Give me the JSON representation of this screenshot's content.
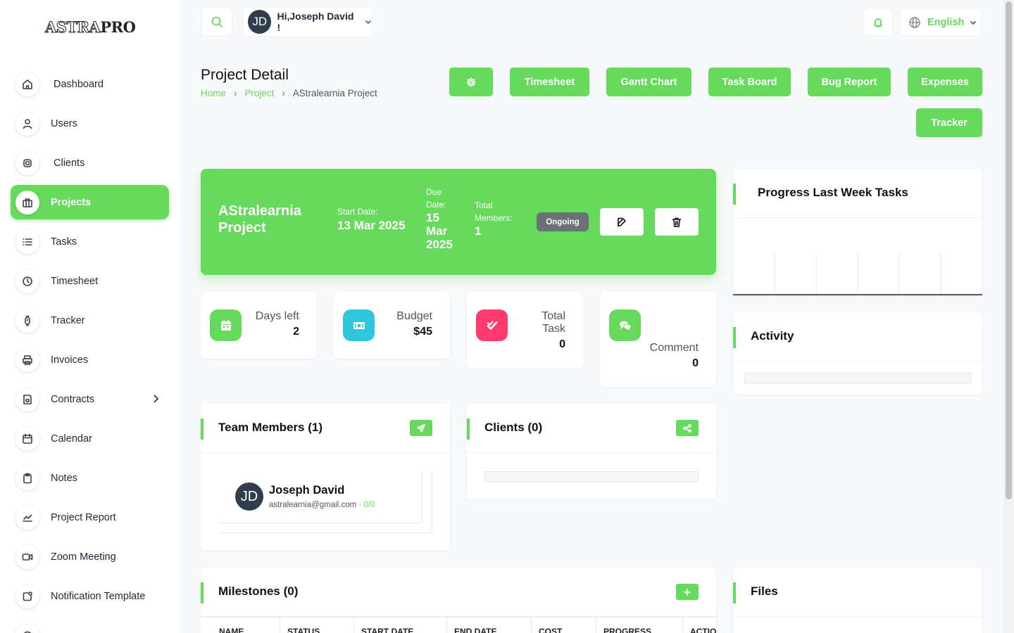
{
  "brand": {
    "logo_outline": "ASTRA",
    "logo_solid": "PRO"
  },
  "sidebar": {
    "items": [
      {
        "label": "Dashboard",
        "icon": "home-icon"
      },
      {
        "label": "Users",
        "icon": "user-icon"
      },
      {
        "label": "Clients",
        "icon": "clients-icon"
      },
      {
        "label": "Projects",
        "icon": "projects-icon",
        "active": true
      },
      {
        "label": "Tasks",
        "icon": "list-icon"
      },
      {
        "label": "Timesheet",
        "icon": "clock-icon"
      },
      {
        "label": "Tracker",
        "icon": "tracker-icon"
      },
      {
        "label": "Invoices",
        "icon": "printer-icon"
      },
      {
        "label": "Contracts",
        "icon": "contract-icon",
        "has_submenu": true
      },
      {
        "label": "Calendar",
        "icon": "calendar-icon"
      },
      {
        "label": "Notes",
        "icon": "clipboard-icon"
      },
      {
        "label": "Project Report",
        "icon": "chart-line-icon"
      },
      {
        "label": "Zoom Meeting",
        "icon": "video-icon"
      },
      {
        "label": "Notification Template",
        "icon": "notification-icon"
      }
    ]
  },
  "header": {
    "user_initials": "JD",
    "greeting": "Hi,Joseph David !",
    "language": "English"
  },
  "page": {
    "title": "Project Detail",
    "breadcrumb": [
      "Home",
      "Project",
      "AStralearnia Project"
    ]
  },
  "actions": {
    "settings_icon": "gear-icon",
    "buttons": [
      "Timesheet",
      "Gantt Chart",
      "Task Board",
      "Bug Report",
      "Expenses",
      "Tracker"
    ]
  },
  "project": {
    "name": "AStralearnia Project",
    "start_label": "Start Date:",
    "start_date": "13 Mar 2025",
    "due_label_1": "Due",
    "due_label_2": "Date:",
    "due_line_1": "15",
    "due_line_2": "Mar",
    "due_line_3": "2025",
    "members_label_1": "Total",
    "members_label_2": "Members:",
    "members_count": "1",
    "status": "Ongoing"
  },
  "stats": {
    "days_left_label": "Days left",
    "days_left": "2",
    "budget_label": "Budget",
    "budget": "$45",
    "total_task_label_1": "Total",
    "total_task_label_2": "Task",
    "total_task": "0",
    "comment_label": "Comment",
    "comment": "0"
  },
  "colors": {
    "accent": "#66da5d",
    "budget_icon_bg": "#2fc6dc",
    "task_icon_bg": "#ff3a6e",
    "badge_bg": "#6b6f76"
  },
  "progress": {
    "title": "Progress Last Week Tasks"
  },
  "activity": {
    "title": "Activity"
  },
  "team": {
    "title": "Team Members (1)",
    "members": [
      {
        "initials": "JD",
        "name": "Joseph David",
        "email": "astralearnia@gmail.com",
        "count": "- 0/0"
      }
    ]
  },
  "clients": {
    "title": "Clients (0)"
  },
  "milestones": {
    "title": "Milestones (0)",
    "columns": [
      "NAME",
      "STATUS",
      "START DATE",
      "END DATE",
      "COST",
      "PROGRESS",
      "ACTIO"
    ]
  },
  "files": {
    "title": "Files"
  }
}
